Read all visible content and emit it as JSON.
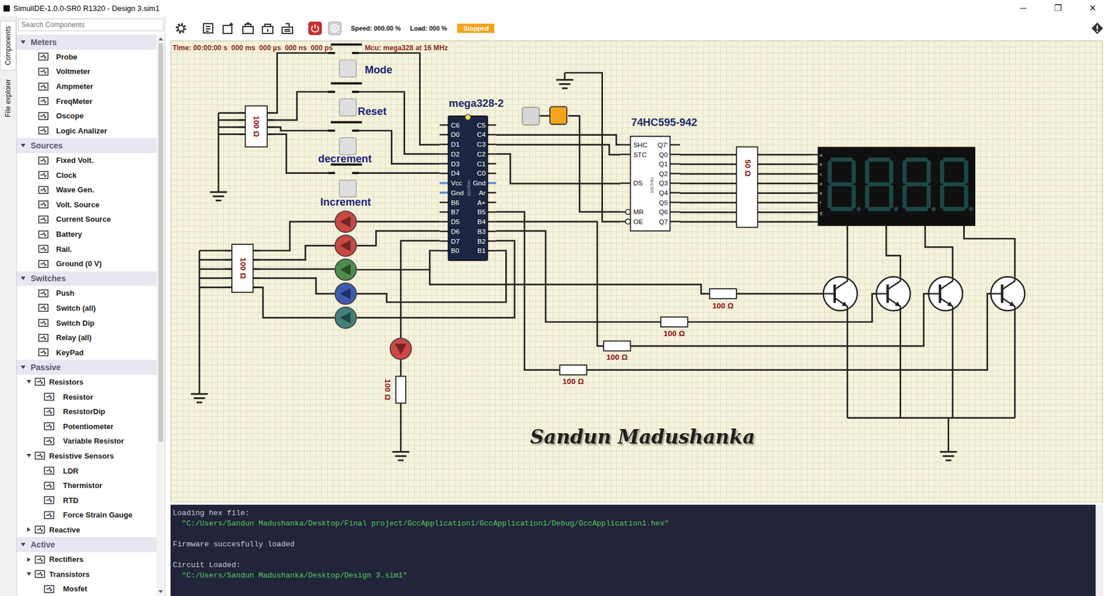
{
  "window": {
    "title": "SimulIDE-1.0.0-SR0 R1320 - Design 3.sim1",
    "controls": [
      "─",
      "❐",
      "✕"
    ]
  },
  "side_tabs": [
    {
      "label": "Components",
      "selected": true
    },
    {
      "label": "File explorer",
      "selected": false
    }
  ],
  "search": {
    "placeholder": "Search Components"
  },
  "tree": [
    {
      "label": "Meters",
      "expanded": true,
      "children": [
        {
          "label": "Probe"
        },
        {
          "label": "Voltmeter"
        },
        {
          "label": "Ampmeter"
        },
        {
          "label": "FreqMeter"
        },
        {
          "label": "Oscope"
        },
        {
          "label": "Logic Analizer"
        }
      ]
    },
    {
      "label": "Sources",
      "expanded": true,
      "children": [
        {
          "label": "Fixed Volt."
        },
        {
          "label": "Clock"
        },
        {
          "label": "Wave Gen."
        },
        {
          "label": "Volt. Source"
        },
        {
          "label": "Current Source"
        },
        {
          "label": "Battery"
        },
        {
          "label": "Rail."
        },
        {
          "label": "Ground (0 V)"
        }
      ]
    },
    {
      "label": "Switches",
      "expanded": true,
      "children": [
        {
          "label": "Push"
        },
        {
          "label": "Switch (all)"
        },
        {
          "label": "Switch Dip"
        },
        {
          "label": "Relay (all)"
        },
        {
          "label": "KeyPad"
        }
      ]
    },
    {
      "label": "Passive",
      "expanded": true,
      "children": [
        {
          "label": "Resistors",
          "expanded": true,
          "children": [
            {
              "label": "Resistor"
            },
            {
              "label": "ResistorDip"
            },
            {
              "label": "Potentiometer"
            },
            {
              "label": "Variable Resistor"
            }
          ]
        },
        {
          "label": "Resistive Sensors",
          "expanded": true,
          "children": [
            {
              "label": "LDR"
            },
            {
              "label": "Thermistor"
            },
            {
              "label": "RTD"
            },
            {
              "label": "Force Strain Gauge"
            }
          ]
        },
        {
          "label": "Reactive",
          "expanded": false,
          "children": []
        }
      ]
    },
    {
      "label": "Active",
      "expanded": true,
      "children": [
        {
          "label": "Rectifiers",
          "expanded": false,
          "children": []
        },
        {
          "label": "Transistors",
          "expanded": true,
          "children": [
            {
              "label": "Mosfet"
            }
          ]
        }
      ]
    }
  ],
  "toolbar": {
    "speed": "Speed: 000.00 %",
    "load": "Load: 000 %",
    "state": "Stopped",
    "running": false
  },
  "canvas": {
    "time": "Time: 00:00:00 s  000 ms  000 µs  000 ns  000 ps",
    "mcu_info": "Mcu: mega328 at 16 MHz",
    "mcu": {
      "name": "mega328-2",
      "part": "mega328",
      "left_pins": [
        {
          "label": "C6",
          "power": false
        },
        {
          "label": "D0",
          "power": false
        },
        {
          "label": "D1",
          "power": false
        },
        {
          "label": "D2",
          "power": false
        },
        {
          "label": "D3",
          "power": false
        },
        {
          "label": "D4",
          "power": false
        },
        {
          "label": "Vcc",
          "power": true
        },
        {
          "label": "Gnd",
          "power": true
        },
        {
          "label": "B6",
          "power": false
        },
        {
          "label": "B7",
          "power": false
        },
        {
          "label": "D5",
          "power": false
        },
        {
          "label": "D6",
          "power": false
        },
        {
          "label": "D7",
          "power": false
        },
        {
          "label": "B0",
          "power": false
        }
      ],
      "right_pins": [
        {
          "label": "C5",
          "power": false
        },
        {
          "label": "C4",
          "power": false
        },
        {
          "label": "C3",
          "power": false
        },
        {
          "label": "C2",
          "power": false
        },
        {
          "label": "C1",
          "power": false
        },
        {
          "label": "C0",
          "power": false
        },
        {
          "label": "Gnd",
          "power": true
        },
        {
          "label": "Ar",
          "power": false
        },
        {
          "label": "A+",
          "power": false
        },
        {
          "label": "B5",
          "power": false
        },
        {
          "label": "B4",
          "power": false
        },
        {
          "label": "B3",
          "power": false
        },
        {
          "label": "B2",
          "power": false
        },
        {
          "label": "B1",
          "power": false
        }
      ]
    },
    "shift_register": {
      "name": "74HC595-942",
      "part": "74HC595",
      "left_pins": [
        {
          "label": "SHC",
          "inverted": false
        },
        {
          "label": "STC",
          "inverted": false
        },
        {
          "label": "DS",
          "inverted": false
        },
        {
          "label": "MR",
          "inverted": true
        },
        {
          "label": "OE",
          "inverted": true
        }
      ],
      "right_pins": [
        "Q7'",
        "Q0",
        "Q1",
        "Q2",
        "Q3",
        "Q4",
        "Q5",
        "Q6",
        "Q7"
      ]
    },
    "push_buttons": [
      {
        "label": "Mode",
        "pressed": false
      },
      {
        "label": "Reset",
        "pressed": false
      },
      {
        "label": "decrement",
        "pressed": false
      },
      {
        "label": "Increment",
        "pressed": false
      }
    ],
    "leds": [
      {
        "color": "#c62828",
        "lit": false
      },
      {
        "color": "#c62828",
        "lit": false
      },
      {
        "color": "#2e7d32",
        "lit": false
      },
      {
        "color": "#1e3fa8",
        "lit": false
      },
      {
        "color": "#1f6e68",
        "lit": false
      },
      {
        "color": "#c62828",
        "lit": false
      }
    ],
    "resistor_dips": [
      {
        "label": "100 Ω"
      },
      {
        "label": "100 Ω"
      },
      {
        "label": "50 Ω"
      }
    ],
    "resistors": [
      {
        "label": "100 Ω"
      },
      {
        "label": "100 Ω"
      },
      {
        "label": "100 Ω"
      },
      {
        "label": "100 Ω"
      },
      {
        "label": "100 Ω"
      }
    ],
    "display": {
      "digits": 4,
      "segments": [
        "a",
        "b",
        "c",
        "d",
        "e",
        "f",
        "g"
      ]
    },
    "sources": [
      {
        "kind": "switch",
        "on": false
      },
      {
        "kind": "fixed_volt",
        "on": true
      }
    ],
    "transistors": [
      {
        "kind": "npn"
      },
      {
        "kind": "npn"
      },
      {
        "kind": "npn"
      },
      {
        "kind": "npn"
      }
    ],
    "signature": "Sandun Madushanka"
  },
  "console": [
    {
      "heading": "Loading hex file:",
      "detail": "\"C:/Users/Sandun Madushanka/Desktop/Final project/GccApplication1/GccApplication1/Debug/GccApplication1.hex\""
    },
    {
      "heading": "Firmware succesfully loaded"
    },
    {
      "heading": "Circuit Loaded:",
      "detail": "\"C:/Users/Sandun Madushanka/Desktop/Design 3.sim1\""
    }
  ]
}
